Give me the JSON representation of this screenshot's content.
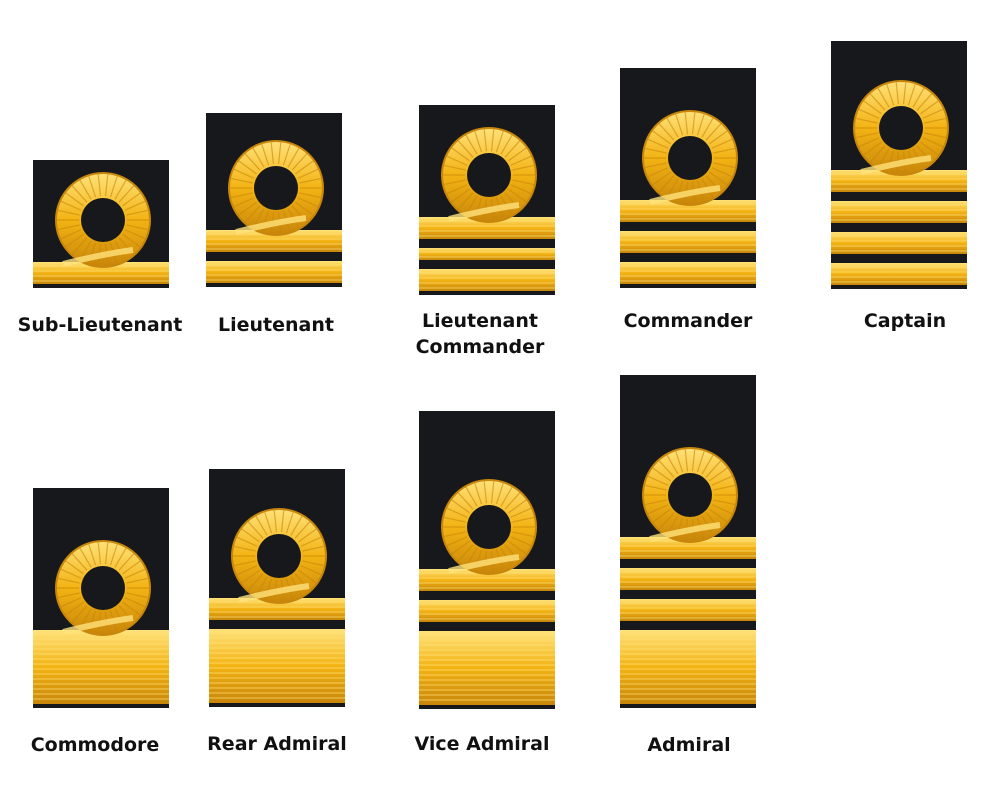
{
  "colors": {
    "cloth": "#17181c",
    "gold": "#f3b313",
    "gold_dark": "#c8860a",
    "gold_light": "#ffe27a"
  },
  "ranks": [
    {
      "key": "sub-lieutenant",
      "label": "Sub-Lieutenant",
      "stripes": [
        "medium"
      ]
    },
    {
      "key": "lieutenant",
      "label": "Lieutenant",
      "stripes": [
        "medium",
        "medium"
      ]
    },
    {
      "key": "lieutenant-commander",
      "label": "Lieutenant\nCommander",
      "stripes": [
        "medium",
        "thin",
        "medium"
      ]
    },
    {
      "key": "commander",
      "label": "Commander",
      "stripes": [
        "medium",
        "medium",
        "medium"
      ]
    },
    {
      "key": "captain",
      "label": "Captain",
      "stripes": [
        "medium",
        "medium",
        "medium",
        "medium"
      ]
    },
    {
      "key": "commodore",
      "label": "Commodore",
      "stripes": [
        "broad"
      ]
    },
    {
      "key": "rear-admiral",
      "label": "Rear Admiral",
      "stripes": [
        "medium",
        "broad"
      ]
    },
    {
      "key": "vice-admiral",
      "label": "Vice Admiral",
      "stripes": [
        "medium",
        "medium",
        "broad"
      ]
    },
    {
      "key": "admiral",
      "label": "Admiral",
      "stripes": [
        "medium",
        "medium",
        "medium",
        "broad"
      ]
    }
  ]
}
